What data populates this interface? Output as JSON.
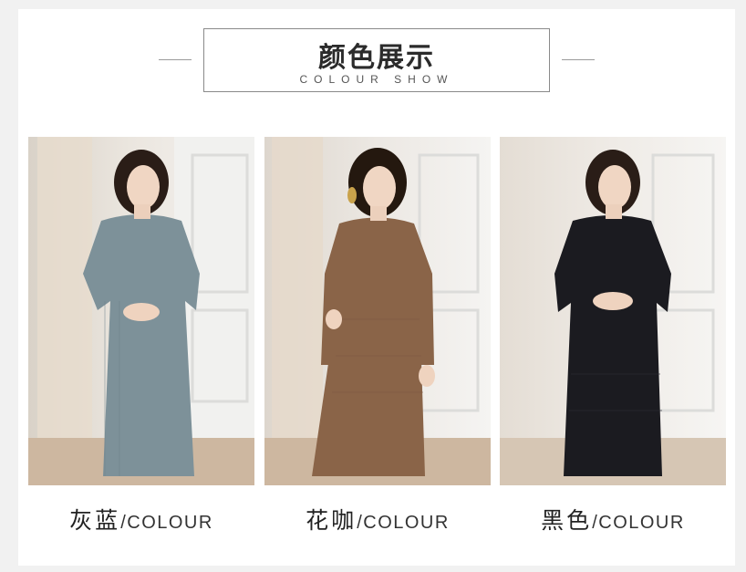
{
  "heading": {
    "title": "颜色展示",
    "subtitle": "COLOUR SHOW"
  },
  "colors": {
    "page_bg": "#f1f1f1",
    "card_bg": "#ffffff",
    "text": "#222222"
  },
  "variants": [
    {
      "name": "灰蓝",
      "suffix": "/COLOUR",
      "dress_color": "#7d9199",
      "dress_icon": "dress-icon"
    },
    {
      "name": "花咖",
      "suffix": "/COLOUR",
      "dress_color": "#8a6448",
      "dress_icon": "dress-icon"
    },
    {
      "name": "黑色",
      "suffix": "/COLOUR",
      "dress_color": "#1b1b20",
      "dress_icon": "dress-icon"
    }
  ]
}
